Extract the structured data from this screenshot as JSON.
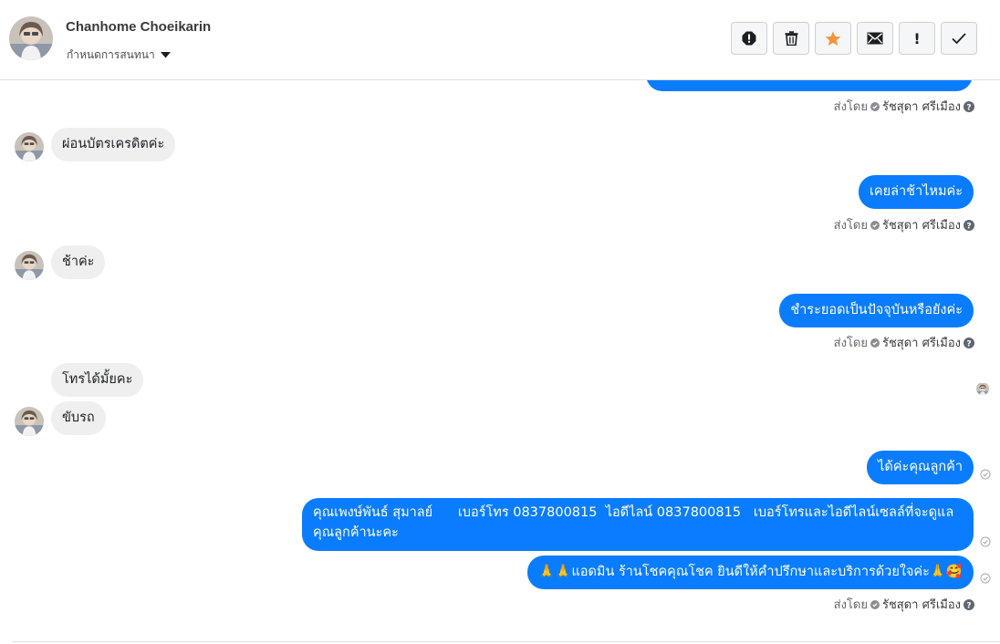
{
  "header": {
    "contact_name": "Chanhome Choeikarin",
    "conversation_settings": "กำหนดการสนทนา",
    "actions": [
      {
        "name": "report-spam-icon"
      },
      {
        "name": "trash-icon"
      },
      {
        "name": "star-icon",
        "color": "#f7923b"
      },
      {
        "name": "mail-icon"
      },
      {
        "name": "exclamation-icon",
        "label": "!"
      },
      {
        "name": "checkmark-icon"
      }
    ]
  },
  "sent_by_label": "ส่งโดย",
  "agent_name": "รัชสุดา ศรีเมือง",
  "messages": [
    {
      "direction": "in",
      "text": "ผ่อนบัตรเครดิตค่ะ"
    },
    {
      "direction": "out",
      "text": "เคยล่าช้าไหมค่ะ"
    },
    {
      "direction": "in",
      "text": "ช้าค่ะ"
    },
    {
      "direction": "out",
      "text": "ชำระยอดเป็นปัจจุบันหรือยังค่ะ"
    },
    {
      "direction": "in",
      "text": "โทรได้มั้ยคะ"
    },
    {
      "direction": "in",
      "text": "ขับรถ"
    },
    {
      "direction": "out",
      "text": "ได้ค่ะคุณลูกค้า"
    },
    {
      "direction": "out",
      "text_line1": "คุณเพงษ์พันธ์ สุมาลย์      เบอร์โทร 0837800815  ไอดีไลน์ 0837800815   เบอร์โทรและไอดีไลน์เซลล์ที่จะดูแล",
      "text_line2": "คุณลูกค้านะคะ"
    },
    {
      "direction": "out",
      "text": "🙏🙏แอดมิน ร้านโชคคุณโชค ยินดีให้คำปรึกษาและบริการด้วยใจค่ะ🙏🥰"
    }
  ],
  "colors": {
    "outgoing_bubble": "#0a7cff",
    "incoming_bubble": "#efefef",
    "accent_star": "#f7923b"
  }
}
